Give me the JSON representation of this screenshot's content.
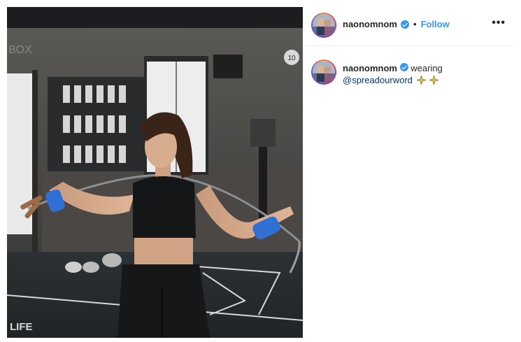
{
  "post": {
    "username": "naonomnom",
    "follow_label": "Follow",
    "separator": "•",
    "more_label": "•••"
  },
  "caption": {
    "username": "naonomnom",
    "text": "wearing",
    "mention": "@spreadourword",
    "emojis": [
      "sparkle-icon",
      "sparkle-icon"
    ]
  },
  "photo_text": {
    "wall_sign": "BOX",
    "clock_number": "10",
    "floor_text": "LIFE"
  },
  "colors": {
    "follow_blue": "#3897f0",
    "mention_blue": "#00376b",
    "verified_blue": "#3897f0",
    "wrap_blue": "#2f6fd6"
  }
}
